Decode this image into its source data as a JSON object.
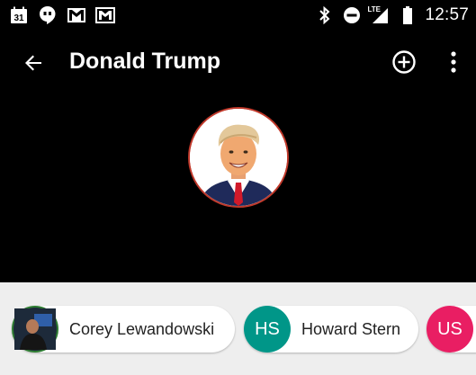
{
  "status_bar": {
    "left_icons": [
      "calendar-icon",
      "hangouts-icon",
      "gmail-icon",
      "gmail-icon"
    ],
    "calendar_day": "31",
    "right_icons": [
      "bluetooth-icon",
      "do-not-disturb-icon",
      "lte-signal-icon",
      "battery-icon"
    ],
    "network_label": "LTE",
    "time": "12:57"
  },
  "app_bar": {
    "title": "Donald Trump",
    "back_icon": "arrow-back-icon",
    "add_icon": "add-circle-icon",
    "more_icon": "more-vert-icon"
  },
  "colors": {
    "background": "#000000",
    "chip_bar": "#eeeeee",
    "hs_avatar": "#009688",
    "us_avatar": "#e91e63",
    "corey_avatar_ring": "#2e7d32"
  },
  "chips": [
    {
      "name": "Corey Lewandowski",
      "initials": "",
      "avatar": "photo"
    },
    {
      "name": "Howard Stern",
      "initials": "HS",
      "avatar": "initials"
    },
    {
      "name": "",
      "initials": "US",
      "avatar": "initials"
    }
  ]
}
